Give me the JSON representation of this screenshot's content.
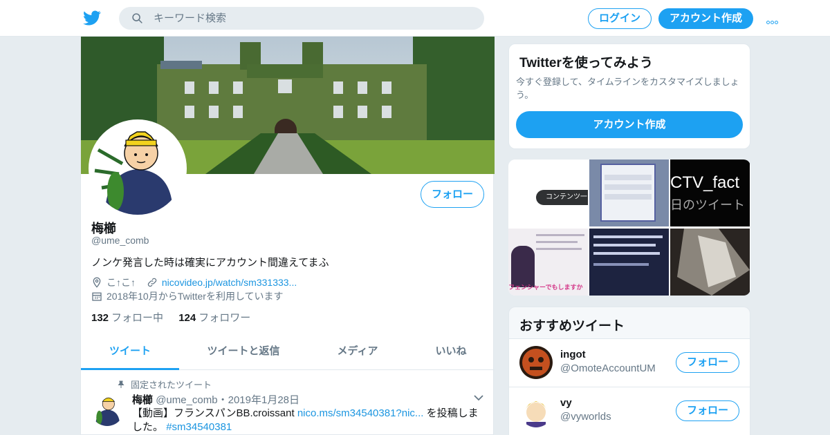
{
  "header": {
    "search_placeholder": "キーワード検索",
    "login_label": "ログイン",
    "signup_label": "アカウント作成"
  },
  "profile": {
    "name": "梅櫛",
    "handle": "@ume_comb",
    "follow_label": "フォロー",
    "bio": "ノンケ発言した時は確実にアカウント間違えてまふ",
    "location": "こ↑こ↑",
    "url": "nicovideo.jp/watch/sm331333...",
    "joined": "2018年10月からTwitterを利用しています",
    "following_count": "132",
    "following_label": "フォロー中",
    "followers_count": "124",
    "followers_label": "フォロワー"
  },
  "tabs": [
    {
      "label": "ツイート"
    },
    {
      "label": "ツイートと返信"
    },
    {
      "label": "メディア"
    },
    {
      "label": "いいね"
    }
  ],
  "pinned_tweet": {
    "pinned_label": "固定されたツイート",
    "author": "梅櫛",
    "handle": "@ume_comb",
    "date": "・2019年1月28日",
    "text_before": "【動画】フランスパンBB.croissant ",
    "link": "nico.ms/sm34540381?nic...",
    "text_after": " を投稿しました。",
    "hashtag": "#sm34540381"
  },
  "sidebar": {
    "try_title": "Twitterを使ってみよう",
    "try_desc": "今すぐ登録して、タイムラインをカスタマイズしましょう。",
    "try_button": "アカウント作成",
    "media_texts": {
      "content_list": "コンテンツ一覧",
      "ctv_fact": "CTV_fact",
      "daily_tweet": "日のツイート",
      "fencer": "フェンシャーでもしますか"
    },
    "recommended_title": "おすすめツイート",
    "recommended": [
      {
        "name": "ingot",
        "handle": "@OmoteAccountUM",
        "follow": "フォロー"
      },
      {
        "name": "vy",
        "handle": "@vyworlds",
        "follow": "フォロー"
      }
    ]
  },
  "colors": {
    "accent": "#1da1f2",
    "background": "#e6ecf0"
  }
}
